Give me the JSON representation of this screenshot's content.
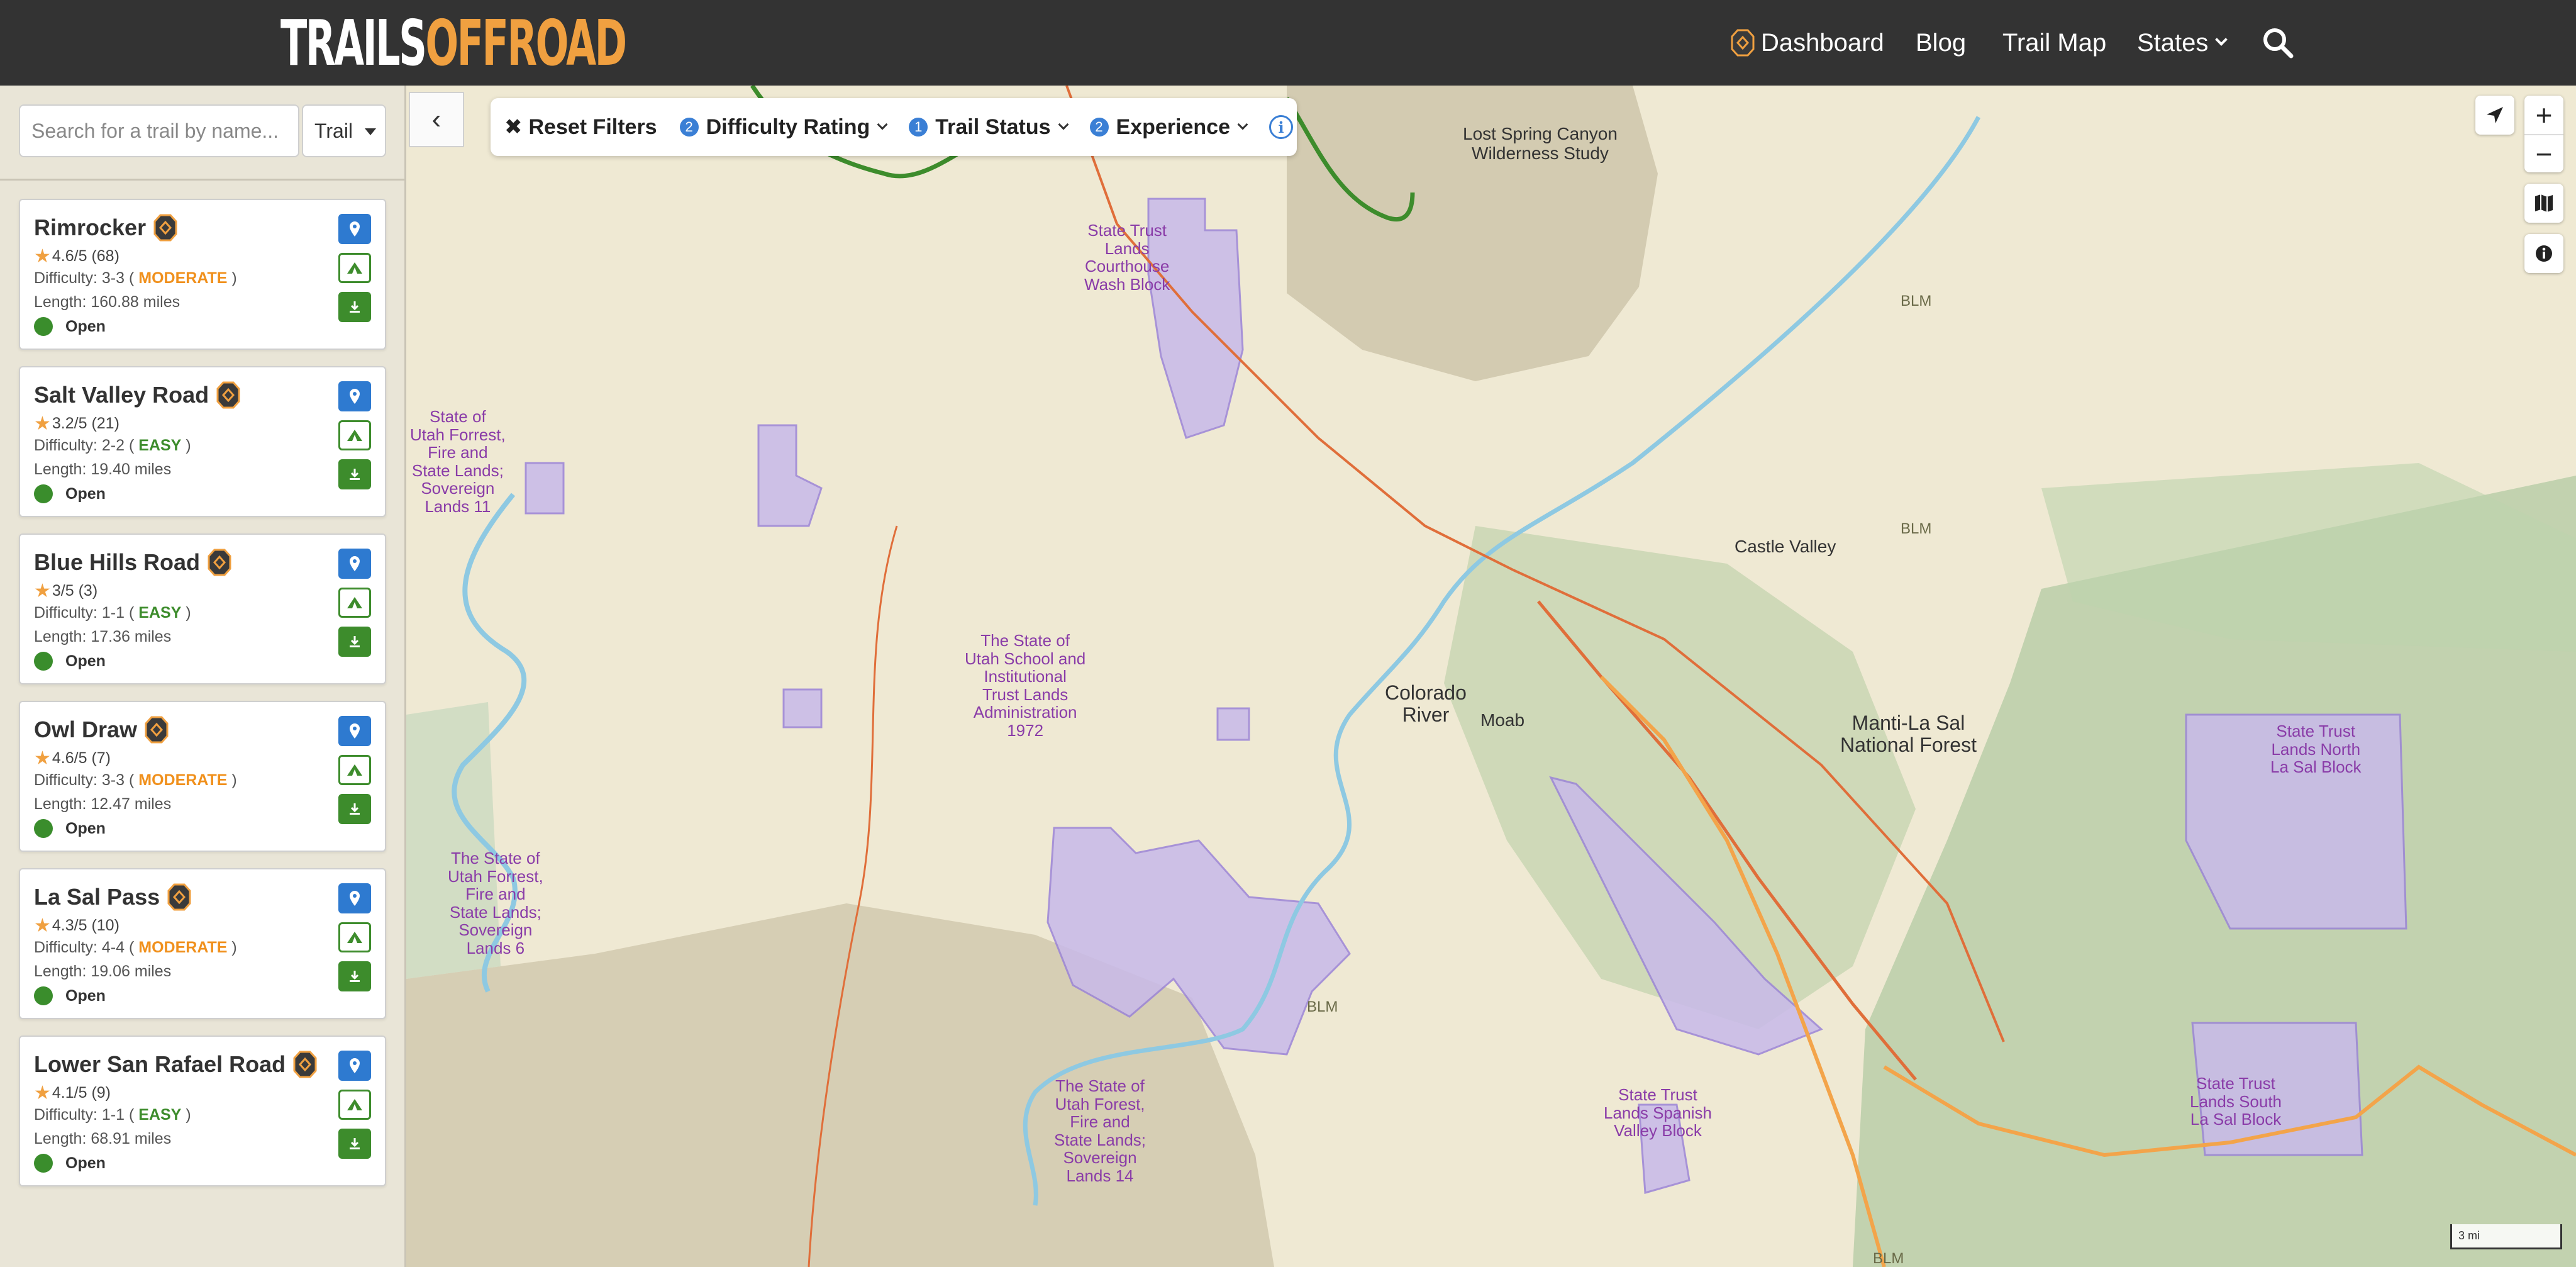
{
  "header": {
    "logo_white": "TRAILS",
    "logo_orange": "OFFROAD",
    "nav": {
      "dashboard": "Dashboard",
      "blog": "Blog",
      "trail_map": "Trail Map",
      "states": "States"
    }
  },
  "sidebar": {
    "search_placeholder": "Search for a trail by name...",
    "type_select": "Trail",
    "trails": [
      {
        "name": "Rimrocker",
        "rating": "4.6/5 (68)",
        "difficulty_prefix": "Difficulty: 3-3 (",
        "difficulty_level": "MODERATE",
        "difficulty_suffix": ")",
        "length": "Length: 160.88 miles",
        "status": "Open"
      },
      {
        "name": "Salt Valley Road",
        "rating": "3.2/5 (21)",
        "difficulty_prefix": "Difficulty: 2-2 (",
        "difficulty_level": "EASY",
        "difficulty_suffix": ")",
        "length": "Length: 19.40 miles",
        "status": "Open"
      },
      {
        "name": "Blue Hills Road",
        "rating": "3/5 (3)",
        "difficulty_prefix": "Difficulty: 1-1 (",
        "difficulty_level": "EASY",
        "difficulty_suffix": ")",
        "length": "Length: 17.36 miles",
        "status": "Open"
      },
      {
        "name": "Owl Draw",
        "rating": "4.6/5 (7)",
        "difficulty_prefix": "Difficulty: 3-3 (",
        "difficulty_level": "MODERATE",
        "difficulty_suffix": ")",
        "length": "Length: 12.47 miles",
        "status": "Open"
      },
      {
        "name": "La Sal Pass",
        "rating": "4.3/5 (10)",
        "difficulty_prefix": "Difficulty: 4-4 (",
        "difficulty_level": "MODERATE",
        "difficulty_suffix": ")",
        "length": "Length: 19.06 miles",
        "status": "Open"
      },
      {
        "name": "Lower San Rafael Road",
        "rating": "4.1/5 (9)",
        "difficulty_prefix": "Difficulty: 1-1 (",
        "difficulty_level": "EASY",
        "difficulty_suffix": ")",
        "length": "Length: 68.91 miles",
        "status": "Open"
      }
    ]
  },
  "filters": {
    "reset": "Reset Filters",
    "difficulty": {
      "count": "2",
      "label": "Difficulty Rating"
    },
    "status": {
      "count": "1",
      "label": "Trail Status"
    },
    "experience": {
      "count": "2",
      "label": "Experience"
    }
  },
  "map": {
    "scale": "3 mi",
    "labels": {
      "lost_spring": "Lost Spring Canyon\nWilderness Study",
      "courthouse": "State Trust\nLands\nCourthouse\nWash Block",
      "sovereign11": "State of\nUtah Forrest,\nFire and\nState Lands;\nSovereign\nLands 11",
      "school": "The State of\nUtah School and\nInstitutional\nTrust Lands\nAdministration\n1972",
      "colorado_river": "Colorado\nRiver",
      "moab": "Moab",
      "castle_valley": "Castle Valley",
      "manti": "Manti-La Sal\nNational Forest",
      "lasal_north": "State Trust\nLands North\nLa Sal Block",
      "lasal_south": "State Trust\nLands South\nLa Sal Block",
      "spanish_valley": "State Trust\nLands Spanish\nValley Block",
      "sovereign6": "The State of\nUtah Forrest,\nFire and\nState Lands;\nSovereign\nLands 6",
      "sovereign14": "The State of\nUtah Forest,\nFire and\nState Lands;\nSovereign\nLands 14",
      "blm": "BLM"
    }
  },
  "colors": {
    "header_bg": "#333333",
    "accent_orange": "#f0a040",
    "button_blue": "#2e7ad0",
    "open_green": "#3a8d2c",
    "moderate": "#f0901c",
    "easy": "#3d8c2c"
  },
  "icons": [
    "badge-icon",
    "search-icon",
    "chevron-down-icon",
    "map-pin-icon",
    "tent-icon",
    "download-icon",
    "close-icon",
    "info-icon",
    "locate-icon",
    "layers-icon",
    "chevron-left-icon"
  ]
}
